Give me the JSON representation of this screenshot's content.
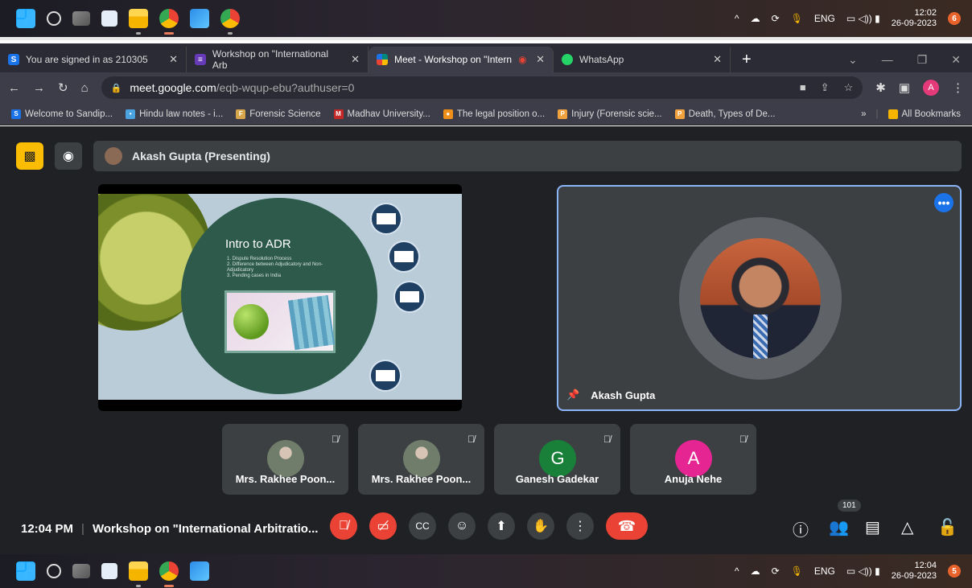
{
  "taskbar_top": {
    "tray_lang": "ENG",
    "clock_time": "12:02",
    "clock_date": "26-09-2023",
    "notif_count": "6"
  },
  "taskbar_bottom": {
    "tray_lang": "ENG",
    "clock_time": "12:04",
    "clock_date": "26-09-2023",
    "notif_count": "5"
  },
  "tabs": [
    {
      "label": "You are signed in as 210305",
      "favicon": "S",
      "color": "#1a73e8"
    },
    {
      "label": "Workshop on \"International Arb",
      "favicon": "≡",
      "color": "#673ab7"
    },
    {
      "label": "Meet - Workshop on \"Intern",
      "favicon": "",
      "color": "#00897b"
    },
    {
      "label": "WhatsApp",
      "favicon": "",
      "color": "#25d366"
    }
  ],
  "address": {
    "host": "meet.google.com",
    "path": "/eqb-wqup-ebu?authuser=0",
    "profile_initial": "A"
  },
  "bookmarks": [
    {
      "label": "Welcome to Sandip...",
      "icon": "S",
      "color": "#1a73e8"
    },
    {
      "label": "Hindu law notes - i...",
      "icon": "•",
      "color": "#4aa3df"
    },
    {
      "label": "Forensic Science",
      "icon": "F",
      "color": "#d7a64b"
    },
    {
      "label": "Madhav University...",
      "icon": "M",
      "color": "#c62828"
    },
    {
      "label": "The legal position o...",
      "icon": "●",
      "color": "#ef8f1a"
    },
    {
      "label": "Injury (Forensic scie...",
      "icon": "P",
      "color": "#f2a23c"
    },
    {
      "label": "Death, Types of De...",
      "icon": "P",
      "color": "#f2a23c"
    }
  ],
  "bookmarks_more": "»",
  "all_bookmarks": "All Bookmarks",
  "presenter_bar": {
    "label": "Akash Gupta (Presenting)"
  },
  "slide": {
    "title": "Intro to ADR",
    "items": [
      "1. Dispute Resolution Process",
      "2. Difference between Adjudicatory and Non-Adjudicatory",
      "3. Pending cases in India"
    ]
  },
  "main_tile": {
    "name": "Akash Gupta",
    "more": "•••"
  },
  "participants": [
    {
      "name": "Mrs. Rakhee Poon...",
      "initial": "",
      "type": "photo"
    },
    {
      "name": "Mrs. Rakhee Poon...",
      "initial": "",
      "type": "photo"
    },
    {
      "name": "Ganesh Gadekar",
      "initial": "G",
      "color": "#188038"
    },
    {
      "name": "Anuja Nehe",
      "initial": "A",
      "color": "#e52592"
    }
  ],
  "controls": {
    "time": "12:04 PM",
    "separator": "|",
    "meeting_title": "Workshop on \"International Arbitratio...",
    "participant_count": "101"
  },
  "colors": {
    "meet_bg": "#202124",
    "tile_bg": "#3c4043",
    "danger": "#ea4335",
    "active_border": "#8ab4f8"
  }
}
